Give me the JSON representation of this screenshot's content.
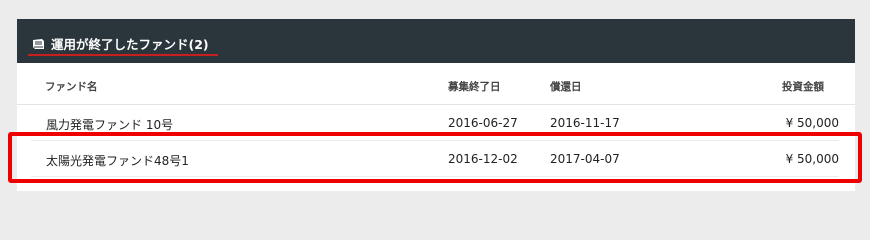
{
  "panel": {
    "title": "運用が終了したファンド(2)",
    "accent_color": "#c81e1e",
    "header_bg": "#2a353c",
    "icon": "book-icon"
  },
  "table": {
    "headers": {
      "name": "ファンド名",
      "end_date": "募集終了日",
      "redemption_date": "償還日",
      "amount": "投資金額"
    },
    "rows": [
      {
        "name": "風力発電ファンド 10号",
        "end_date": "2016-06-27",
        "redemption_date": "2016-11-17",
        "amount": "¥ 50,000"
      },
      {
        "name": "太陽光発電ファンド48号1",
        "end_date": "2016-12-02",
        "redemption_date": "2017-04-07",
        "amount": "¥ 50,000"
      }
    ]
  },
  "highlight": {
    "color": "#ee0000",
    "target": "table.rows.1"
  }
}
